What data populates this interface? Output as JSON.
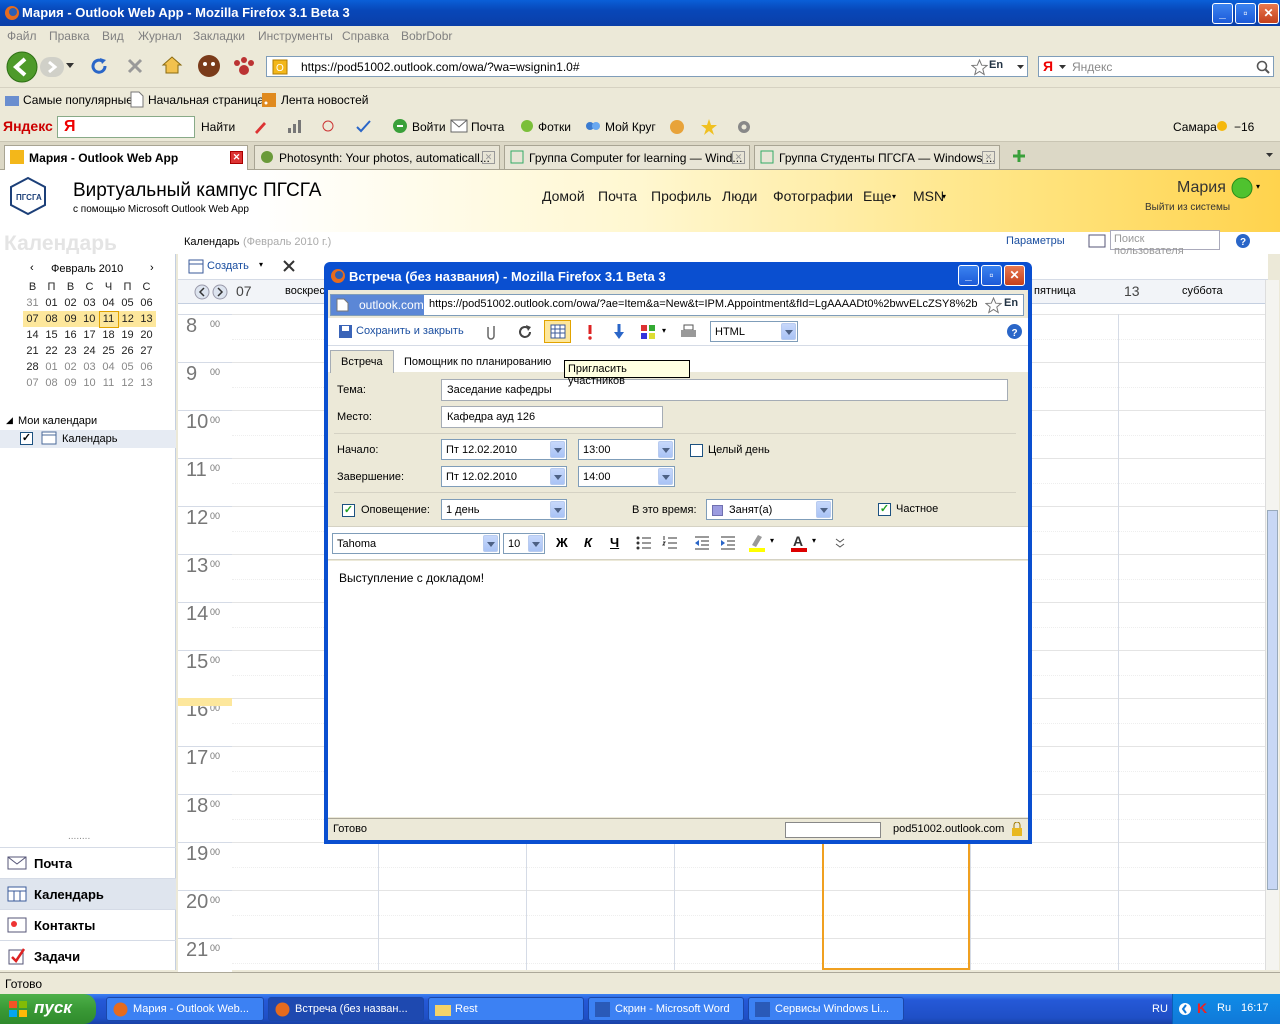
{
  "window": {
    "title": "Мария - Outlook Web App - Mozilla Firefox 3.1 Beta 3"
  },
  "menu": [
    "Файл",
    "Правка",
    "Вид",
    "Журнал",
    "Закладки",
    "Инструменты",
    "Справка",
    "BobrDobr"
  ],
  "nav": {
    "url": "https://pod51002.outlook.com/owa/?wa=wsignin1.0#",
    "lang": "En",
    "search_placeholder": "Яндекс"
  },
  "bookmarks": [
    "Самые популярные",
    "Начальная страница",
    "Лента новостей"
  ],
  "yandex_bar": {
    "logo": "Яндекс",
    "find": "Найти",
    "login": "Войти",
    "mail": "Почта",
    "photos": "Фотки",
    "circle": "Мой Круг",
    "city": "Самара",
    "temp": "−16"
  },
  "tabs": [
    {
      "label": "Мария - Outlook Web App",
      "active": true
    },
    {
      "label": "Photosynth: Your photos, automaticall...",
      "active": false
    },
    {
      "label": "Группа Computer for learning — Wind...",
      "active": false
    },
    {
      "label": "Группа Студенты ПГСГА — Windows ...",
      "active": false
    }
  ],
  "owa": {
    "logo": "ПГСГА",
    "site_title": "Виртуальный кампус ПГСГА",
    "site_sub": "с помощью Microsoft Outlook Web App",
    "nav": [
      "Домой",
      "Почта",
      "Профиль",
      "Люди",
      "Фотографии",
      "Еще",
      "MSN"
    ],
    "user": "Мария",
    "signout": "Выйти из системы",
    "section": "Календарь",
    "breadcrumb": "Календарь",
    "breadcrumb_sub": "(Февраль 2010 г.)",
    "options": "Параметры",
    "find_user": "Поиск пользователя",
    "create": "Создать"
  },
  "mini_calendar": {
    "month": "Февраль 2010",
    "days": [
      "В",
      "П",
      "В",
      "С",
      "Ч",
      "П",
      "С"
    ],
    "weeks": [
      [
        "31",
        "01",
        "02",
        "03",
        "04",
        "05",
        "06"
      ],
      [
        "07",
        "08",
        "09",
        "10",
        "11",
        "12",
        "13"
      ],
      [
        "14",
        "15",
        "16",
        "17",
        "18",
        "19",
        "20"
      ],
      [
        "21",
        "22",
        "23",
        "24",
        "25",
        "26",
        "27"
      ],
      [
        "28",
        "01",
        "02",
        "03",
        "04",
        "05",
        "06"
      ],
      [
        "07",
        "08",
        "09",
        "10",
        "11",
        "12",
        "13"
      ]
    ]
  },
  "my_calendars": {
    "header": "Мои календари",
    "item": "Календарь"
  },
  "left_nav": [
    "Почта",
    "Календарь",
    "Контакты",
    "Задачи"
  ],
  "week_header": {
    "start_num": "07",
    "start_day": "воскрес",
    "fri": "пятница",
    "end_num": "13",
    "end_day": "суббота"
  },
  "hours": [
    "8",
    "9",
    "10",
    "11",
    "12",
    "13",
    "14",
    "15",
    "16",
    "17",
    "18",
    "19",
    "20",
    "21"
  ],
  "hour_min": "00",
  "status": "Готово",
  "taskbar": {
    "start": "пуск",
    "tasks": [
      "Мария - Outlook Web...",
      "Встреча (без назван...",
      "Rest",
      "Скрин - Microsoft Word",
      "Сервисы Windows Li..."
    ],
    "lang": "RU",
    "kbd": "Ru",
    "time": "16:17"
  },
  "popup": {
    "title": "Встреча (без названия) - Mozilla Firefox 3.1 Beta 3",
    "site": "outlook.com",
    "url": "https://pod51002.outlook.com/owa/?ae=Item&a=New&t=IPM.Appointment&fId=LgAAAADt0%2bwvELcZSY8%2b",
    "lang": "En",
    "save": "Сохранить и закрыть",
    "format": "HTML",
    "tab1": "Встреча",
    "tab2": "Помощник по планированию",
    "tooltip": "Пригласить участников",
    "subject_label": "Тема:",
    "subject": "Заседание кафедры",
    "location_label": "Место:",
    "location": "Кафедра ауд 126",
    "start_label": "Начало:",
    "start_date": "Пт 12.02.2010",
    "start_time": "13:00",
    "allday": "Целый день",
    "end_label": "Завершение:",
    "end_date": "Пт 12.02.2010",
    "end_time": "14:00",
    "reminder_label": "Оповещение:",
    "reminder": "1 день",
    "busy_label": "В это время:",
    "busy": "Занят(а)",
    "private": "Частное",
    "font": "Tahoma",
    "size": "10",
    "bold": "Ж",
    "italic": "К",
    "underline": "Ч",
    "body": "Выступление с докладом!",
    "status": "Готово",
    "host": "pod51002.outlook.com"
  }
}
